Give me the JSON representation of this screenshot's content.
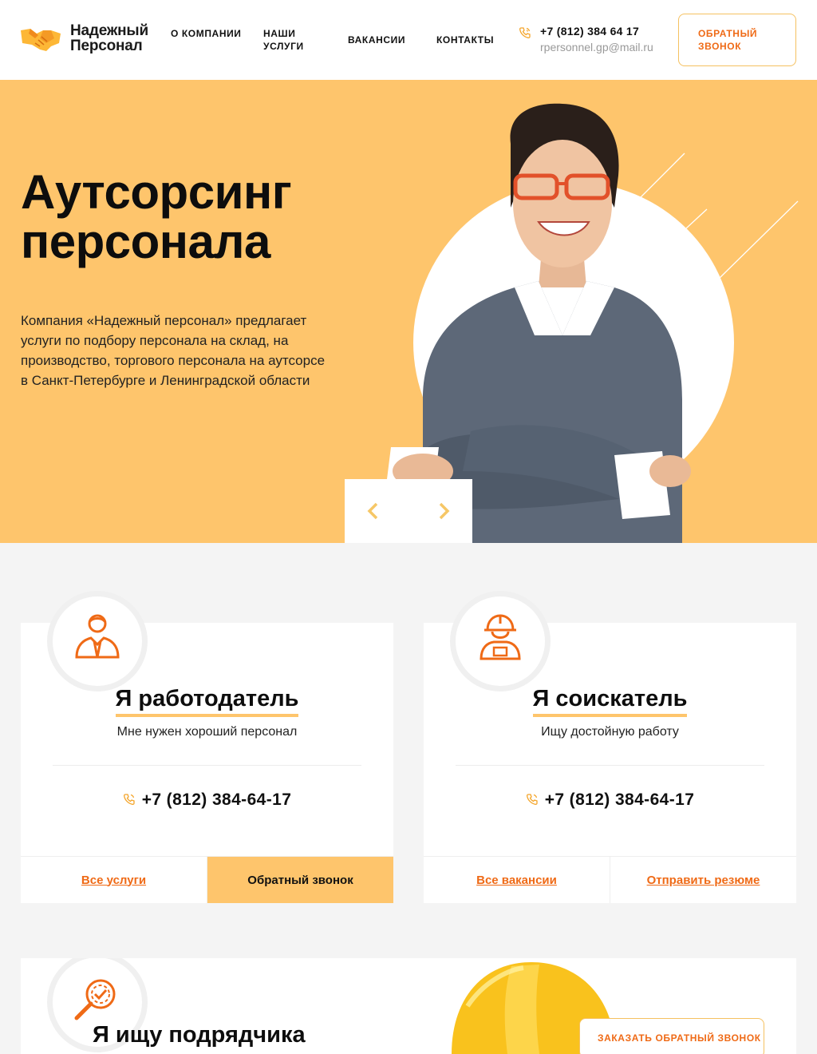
{
  "header": {
    "logo_line1": "Надежный",
    "logo_line2": "Персонал",
    "nav": [
      {
        "label": "О компании"
      },
      {
        "label": "Наши услуги"
      },
      {
        "label": "Вакансии"
      },
      {
        "label": "Контакты"
      }
    ],
    "phone": "+7 (812) 384 64 17",
    "email": "rpersonnel.gp@mail.ru",
    "callback_label": "Обратный звонок"
  },
  "hero": {
    "title_line1": "Аутсорсинг",
    "title_line2": "персонала",
    "text": "Компания «Надежный персонал» предлагает услуги по подбору персонала на склад, на производство, торгового персонала на аутсорсе в Санкт-Петербурге и Ленинградской области"
  },
  "cards": [
    {
      "title": "Я работодатель",
      "subtitle": "Мне нужен хороший персонал",
      "phone": "+7 (812) 384-64-17",
      "action1": "Все услуги",
      "action2": "Обратный звонок"
    },
    {
      "title": "Я соискатель",
      "subtitle": "Ищу достойную работу",
      "phone": "+7 (812) 384-64-17",
      "action1": "Все вакансии",
      "action2": "Отправить резюме"
    }
  ],
  "contractor": {
    "title": "Я ищу подрядчика",
    "button": "Заказать обратный звонок"
  },
  "colors": {
    "accent": "#fec56c",
    "orange": "#ef6a16"
  }
}
